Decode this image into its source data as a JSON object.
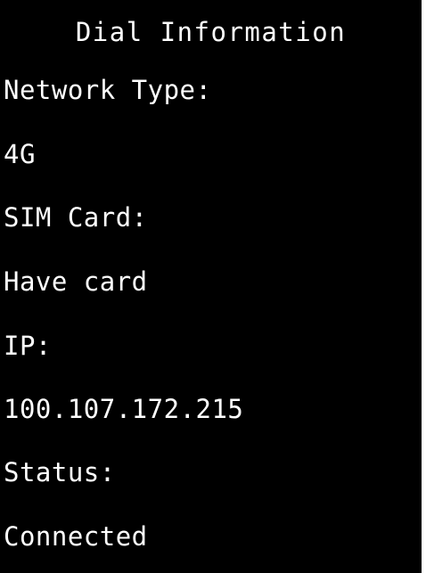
{
  "title": "Dial Information",
  "fields": {
    "network_type_label": "Network Type:",
    "network_type_value": "4G",
    "sim_card_label": "SIM Card:",
    "sim_card_value": "Have card",
    "ip_label": "IP:",
    "ip_value": "100.107.172.215",
    "status_label": "Status:",
    "status_value": "Connected"
  },
  "colors": {
    "background": "#000000",
    "text": "#ffffff"
  }
}
